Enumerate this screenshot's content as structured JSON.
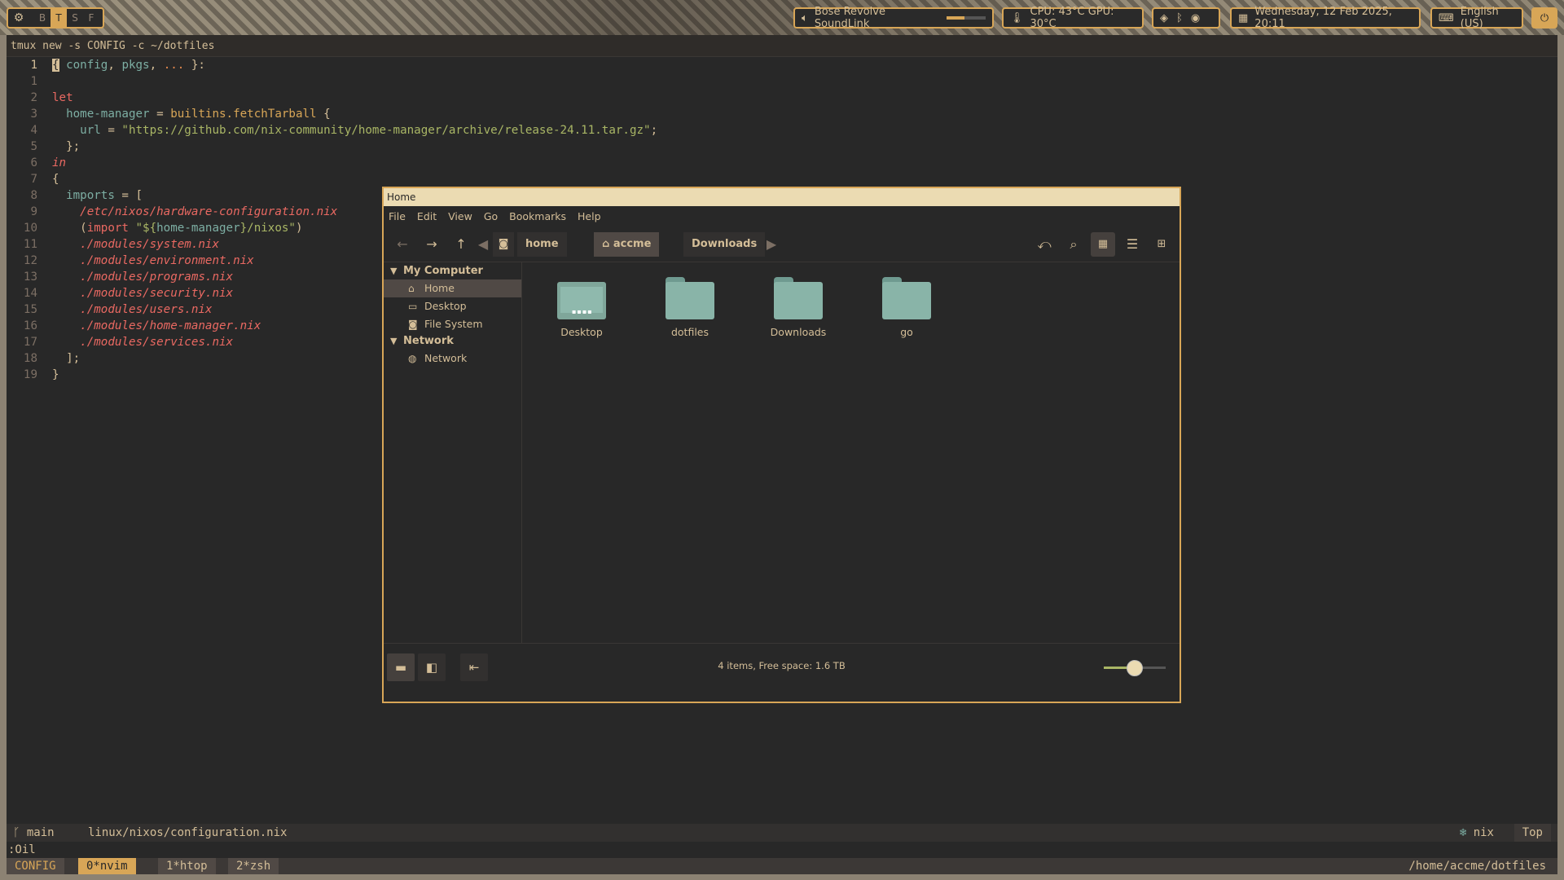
{
  "topbar": {
    "workspaces": [
      "B",
      "T",
      "S",
      "F"
    ],
    "active_workspace": "T",
    "audio": {
      "device": "Bose Revolve SoundLink",
      "volume": 0.45
    },
    "temps": "CPU: 43°C GPU: 30°C",
    "datetime": "Wednesday, 12 Feb 2025, 20:11",
    "language": "English (US)",
    "icons": [
      "gear-icon",
      "speaker-icon",
      "thermometer-icon",
      "layers-icon",
      "bluetooth-icon",
      "steam-icon",
      "calendar-icon",
      "keyboard-icon",
      "power-icon"
    ]
  },
  "terminal": {
    "title": "tmux new -s CONFIG -c ~/dotfiles",
    "statusline": {
      "branch": "main",
      "file": "linux/nixos/configuration.nix",
      "filetype": "nix",
      "position": "Top"
    },
    "cmdline": ":Oil",
    "tmux": {
      "session": "CONFIG",
      "windows": [
        "0*nvim",
        "1*htop",
        "2*zsh"
      ],
      "path": "/home/accme/dotfiles"
    }
  },
  "editor": {
    "line_numbers": [
      "1",
      "1",
      "2",
      "3",
      "4",
      "5",
      "6",
      "7",
      "8",
      "9",
      "10",
      "11",
      "12",
      "13",
      "14",
      "15",
      "16",
      "17",
      "18",
      "19"
    ],
    "tokens": {
      "config": "config",
      "pkgs": "pkgs",
      "dots": "...",
      "let": "let",
      "hm": "home-manager",
      "fetch": "builtins.fetchTarball",
      "url_key": "url",
      "url": "\"https://github.com/nix-community/home-manager/archive/release-24.11.tar.gz\"",
      "in": "in",
      "imports": "imports",
      "p_hw": "/etc/nixos/hardware-configuration.nix",
      "import": "import",
      "hm_str_a": "\"${",
      "hm_str_b": "home-manager",
      "hm_str_c": "}/nixos\"",
      "p_system": "./modules/system.nix",
      "p_env": "./modules/environment.nix",
      "p_programs": "./modules/programs.nix",
      "p_security": "./modules/security.nix",
      "p_users": "./modules/users.nix",
      "p_hm": "./modules/home-manager.nix",
      "p_services": "./modules/services.nix"
    }
  },
  "filemanager": {
    "title": "Home",
    "menu": [
      "File",
      "Edit",
      "View",
      "Go",
      "Bookmarks",
      "Help"
    ],
    "breadcrumbs": [
      "home",
      "accme",
      "Downloads"
    ],
    "active_crumb": "accme",
    "sidebar": {
      "sections": [
        {
          "title": "My Computer",
          "items": [
            "Home",
            "Desktop",
            "File System"
          ]
        },
        {
          "title": "Network",
          "items": [
            "Network"
          ]
        }
      ],
      "selected": "Home"
    },
    "files": [
      "Desktop",
      "dotfiles",
      "Downloads",
      "go"
    ],
    "status": "4 items, Free space: 1.6 TB",
    "zoom": 0.5,
    "colors": {
      "accent": "#d8a657",
      "folder": "#89b4a8"
    }
  }
}
